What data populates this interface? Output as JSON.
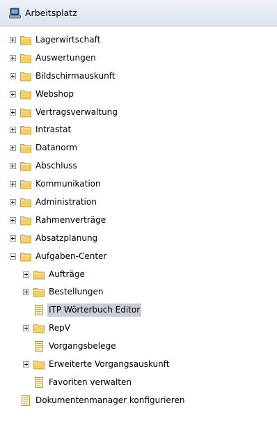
{
  "header": {
    "title": "Arbeitsplatz",
    "icon": "computer-icon"
  },
  "tree": [
    {
      "name": "tree-node-lagerwirtschaft",
      "label": "Lagerwirtschaft",
      "level": 0,
      "icon": "folder-icon",
      "expander": "plus"
    },
    {
      "name": "tree-node-auswertungen",
      "label": "Auswertungen",
      "level": 0,
      "icon": "folder-icon",
      "expander": "plus"
    },
    {
      "name": "tree-node-bildschirmauskunft",
      "label": "Bildschirmauskunft",
      "level": 0,
      "icon": "folder-icon",
      "expander": "plus"
    },
    {
      "name": "tree-node-webshop",
      "label": "Webshop",
      "level": 0,
      "icon": "folder-icon",
      "expander": "plus"
    },
    {
      "name": "tree-node-vertragsverwaltung",
      "label": "Vertragsverwaltung",
      "level": 0,
      "icon": "folder-icon",
      "expander": "plus"
    },
    {
      "name": "tree-node-intrastat",
      "label": "Intrastat",
      "level": 0,
      "icon": "folder-icon",
      "expander": "plus"
    },
    {
      "name": "tree-node-datanorm",
      "label": "Datanorm",
      "level": 0,
      "icon": "folder-icon",
      "expander": "plus"
    },
    {
      "name": "tree-node-abschluss",
      "label": "Abschluss",
      "level": 0,
      "icon": "folder-icon",
      "expander": "plus"
    },
    {
      "name": "tree-node-kommunikation",
      "label": "Kommunikation",
      "level": 0,
      "icon": "folder-icon",
      "expander": "plus"
    },
    {
      "name": "tree-node-administration",
      "label": "Administration",
      "level": 0,
      "icon": "folder-icon",
      "expander": "plus"
    },
    {
      "name": "tree-node-rahmenvertraege",
      "label": "Rahmenverträge",
      "level": 0,
      "icon": "folder-icon",
      "expander": "plus"
    },
    {
      "name": "tree-node-absatzplanung",
      "label": "Absatzplanung",
      "level": 0,
      "icon": "folder-icon",
      "expander": "plus"
    },
    {
      "name": "tree-node-aufgaben-center",
      "label": "Aufgaben-Center",
      "level": 0,
      "icon": "folder-icon",
      "expander": "minus"
    },
    {
      "name": "tree-node-auftraege",
      "label": "Aufträge",
      "level": 1,
      "icon": "folder-icon",
      "expander": "plus"
    },
    {
      "name": "tree-node-bestellungen",
      "label": "Bestellungen",
      "level": 1,
      "icon": "folder-icon",
      "expander": "plus"
    },
    {
      "name": "tree-node-itp-woerterbuch-editor",
      "label": "ITP Wörterbuch Editor",
      "level": 1,
      "icon": "document-icon",
      "expander": "none",
      "selected": true
    },
    {
      "name": "tree-node-repv",
      "label": "RepV",
      "level": 1,
      "icon": "folder-icon",
      "expander": "plus"
    },
    {
      "name": "tree-node-vorgangsbelege",
      "label": "Vorgangsbelege",
      "level": 1,
      "icon": "document-icon",
      "expander": "none"
    },
    {
      "name": "tree-node-erweiterte-vorgangsauskunft",
      "label": "Erweiterte Vorgangsauskunft",
      "level": 1,
      "icon": "folder-icon",
      "expander": "plus"
    },
    {
      "name": "tree-node-favoriten-verwalten",
      "label": "Favoriten verwalten",
      "level": 1,
      "icon": "document-icon",
      "expander": "none"
    },
    {
      "name": "tree-node-dokumentenmanager-konfigurieren",
      "label": "Dokumentenmanager konfigurieren",
      "level": 0,
      "icon": "document-icon",
      "expander": "none"
    }
  ],
  "colors": {
    "folder": "#f3cf6a",
    "folder_edge": "#c9a234",
    "selection": "#c9cdd7",
    "expander_border": "#919b9c"
  }
}
